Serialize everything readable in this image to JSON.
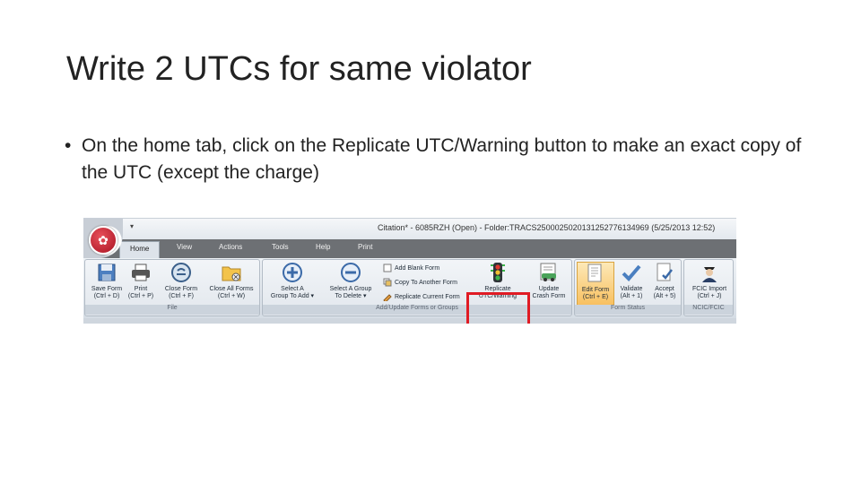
{
  "slide": {
    "title": "Write 2 UTCs for same violator",
    "bullet": "On the home tab, click on the Replicate UTC/Warning button to make an exact copy of the UTC (except the charge)"
  },
  "app": {
    "window_title": "Citation* - 6085RZH (Open) - Folder:TRACS2500025020131252776134969 (5/25/2013 12:52)",
    "qat_arrow": "▾",
    "tabs": [
      "Home",
      "View",
      "Actions",
      "Tools",
      "Help",
      "Print"
    ],
    "active_tab": "Home",
    "groups": {
      "file": {
        "label": "File",
        "buttons": [
          {
            "label": "Save Form",
            "shortcut": "(Ctrl + D)",
            "icon": "save-icon"
          },
          {
            "label": "Print",
            "shortcut": "(Ctrl + P)",
            "icon": "printer-icon"
          },
          {
            "label": "Close Form",
            "shortcut": "(Ctrl + F)",
            "icon": "close-form-icon"
          },
          {
            "label": "Close All Forms",
            "shortcut": "(Ctrl + W)",
            "icon": "folder-close-icon"
          }
        ]
      },
      "add_update": {
        "label": "Add/Update Forms or Groups",
        "buttons": [
          {
            "label": "Select A",
            "sublabel": "Group To Add ▾",
            "icon": "add-circle-icon"
          },
          {
            "label": "Select A Group",
            "sublabel": "To Delete ▾",
            "icon": "remove-circle-icon"
          }
        ],
        "small_buttons": [
          "Add Blank Form",
          "Copy To Another Form",
          "Replicate Current Form"
        ],
        "replicate": {
          "label": "Replicate",
          "sublabel": "UTC/Warning",
          "icon": "traffic-light-icon"
        },
        "update": {
          "label": "Update",
          "sublabel": "Crash Form",
          "icon": "crash-update-icon"
        }
      },
      "form_status": {
        "label": "Form Status",
        "buttons": [
          {
            "label": "Edit Form",
            "shortcut": "(Ctrl + E)",
            "icon": "edit-form-icon"
          },
          {
            "label": "Validate",
            "shortcut": "(Alt + 1)",
            "icon": "validate-check-icon"
          },
          {
            "label": "Accept",
            "shortcut": "(Alt + 5)",
            "icon": "accept-form-icon"
          }
        ]
      },
      "ncic": {
        "label": "NCIC/FCIC",
        "buttons": [
          {
            "label": "FCIC Import",
            "shortcut": "(Ctrl + J)",
            "icon": "officer-icon"
          }
        ]
      }
    }
  },
  "colors": {
    "highlight": "#e01b24",
    "tabbar": "#6d7074",
    "ribbon": "#dde3ea"
  }
}
